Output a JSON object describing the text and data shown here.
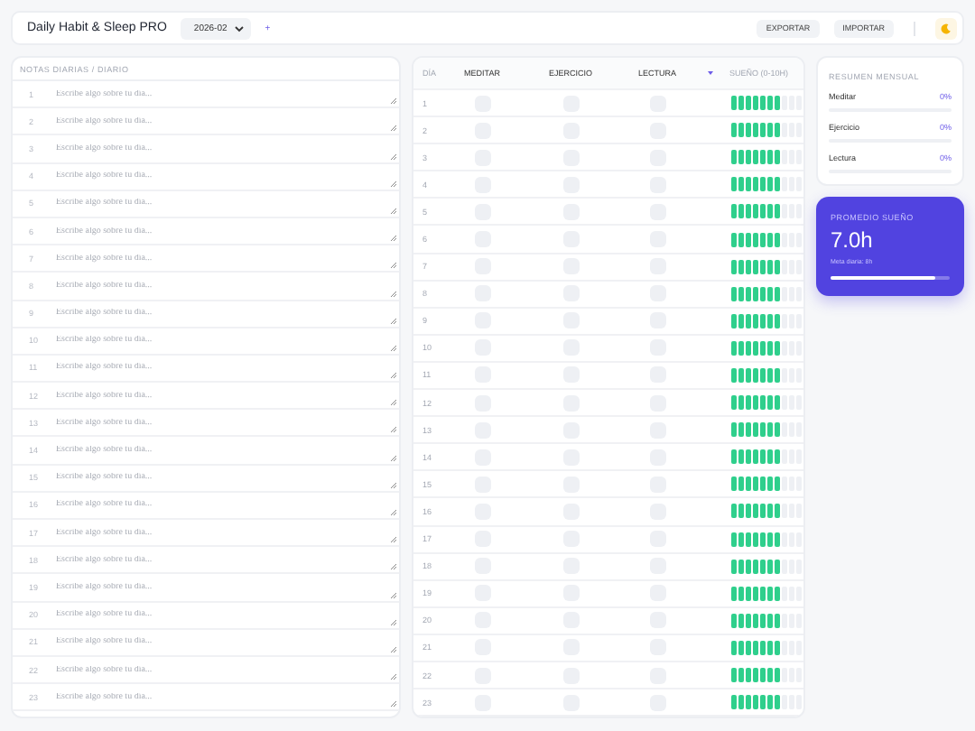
{
  "header": {
    "title": "Daily Habit & Sleep PRO",
    "month": "2026-02",
    "add": "+",
    "buttons": [
      "EXPORTAR",
      "IMPORTAR"
    ]
  },
  "notes": {
    "title": "NOTAS DIARIAS / DIARIO",
    "rows": [
      {
        "day": "1",
        "placeholder": "Escribe algo sobre tu día..."
      },
      {
        "day": "2",
        "placeholder": "Escribe algo sobre tu día..."
      },
      {
        "day": "3",
        "placeholder": "Escribe algo sobre tu día..."
      },
      {
        "day": "4",
        "placeholder": "Escribe algo sobre tu día..."
      },
      {
        "day": "5",
        "placeholder": "Escribe algo sobre tu día..."
      },
      {
        "day": "6",
        "placeholder": "Escribe algo sobre tu día..."
      },
      {
        "day": "7",
        "placeholder": "Escribe algo sobre tu día..."
      },
      {
        "day": "8",
        "placeholder": "Escribe algo sobre tu día..."
      },
      {
        "day": "9",
        "placeholder": "Escribe algo sobre tu día..."
      },
      {
        "day": "10",
        "placeholder": "Escribe algo sobre tu día..."
      },
      {
        "day": "11",
        "placeholder": "Escribe algo sobre tu día..."
      },
      {
        "day": "12",
        "placeholder": "Escribe algo sobre tu día..."
      },
      {
        "day": "13",
        "placeholder": "Escribe algo sobre tu día..."
      },
      {
        "day": "14",
        "placeholder": "Escribe algo sobre tu día..."
      },
      {
        "day": "15",
        "placeholder": "Escribe algo sobre tu día..."
      },
      {
        "day": "16",
        "placeholder": "Escribe algo sobre tu día..."
      },
      {
        "day": "17",
        "placeholder": "Escribe algo sobre tu día..."
      },
      {
        "day": "18",
        "placeholder": "Escribe algo sobre tu día..."
      },
      {
        "day": "19",
        "placeholder": "Escribe algo sobre tu día..."
      },
      {
        "day": "20",
        "placeholder": "Escribe algo sobre tu día..."
      },
      {
        "day": "21",
        "placeholder": "Escribe algo sobre tu día..."
      },
      {
        "day": "22",
        "placeholder": "Escribe algo sobre tu día..."
      },
      {
        "day": "23",
        "placeholder": "Escribe algo sobre tu día..."
      }
    ]
  },
  "tracker": {
    "columns": [
      "DÍA",
      "MEDITAR",
      "EJERCICIO",
      "LECTURA",
      "SUEÑO (0-10H)"
    ],
    "rows": [
      {
        "day": "1",
        "checks": [
          false,
          false,
          false
        ],
        "level": 0.7
      },
      {
        "day": "2",
        "checks": [
          false,
          false,
          false
        ],
        "level": 0.7
      },
      {
        "day": "3",
        "checks": [
          false,
          false,
          false
        ],
        "level": 0.7
      },
      {
        "day": "4",
        "checks": [
          false,
          false,
          false
        ],
        "level": 0.7
      },
      {
        "day": "5",
        "checks": [
          false,
          false,
          false
        ],
        "level": 0.7
      },
      {
        "day": "6",
        "checks": [
          false,
          false,
          false
        ],
        "level": 0.7
      },
      {
        "day": "7",
        "checks": [
          false,
          false,
          false
        ],
        "level": 0.7
      },
      {
        "day": "8",
        "checks": [
          false,
          false,
          false
        ],
        "level": 0.7
      },
      {
        "day": "9",
        "checks": [
          false,
          false,
          false
        ],
        "level": 0.7
      },
      {
        "day": "10",
        "checks": [
          false,
          false,
          false
        ],
        "level": 0.7
      },
      {
        "day": "11",
        "checks": [
          false,
          false,
          false
        ],
        "level": 0.7
      },
      {
        "day": "12",
        "checks": [
          false,
          false,
          false
        ],
        "level": 0.7
      },
      {
        "day": "13",
        "checks": [
          false,
          false,
          false
        ],
        "level": 0.7
      },
      {
        "day": "14",
        "checks": [
          false,
          false,
          false
        ],
        "level": 0.7
      },
      {
        "day": "15",
        "checks": [
          false,
          false,
          false
        ],
        "level": 0.7
      },
      {
        "day": "16",
        "checks": [
          false,
          false,
          false
        ],
        "level": 0.7
      },
      {
        "day": "17",
        "checks": [
          false,
          false,
          false
        ],
        "level": 0.7
      },
      {
        "day": "18",
        "checks": [
          false,
          false,
          false
        ],
        "level": 0.7
      },
      {
        "day": "19",
        "checks": [
          false,
          false,
          false
        ],
        "level": 0.7
      },
      {
        "day": "20",
        "checks": [
          false,
          false,
          false
        ],
        "level": 0.7
      },
      {
        "day": "21",
        "checks": [
          false,
          false,
          false
        ],
        "level": 0.7
      },
      {
        "day": "22",
        "checks": [
          false,
          false,
          false
        ],
        "level": 0.7
      },
      {
        "day": "23",
        "checks": [
          false,
          false,
          false
        ],
        "level": 0.7
      }
    ]
  },
  "summary": {
    "title": "RESUMEN MENSUAL",
    "items": [
      {
        "label": "Meditar",
        "value": "0%"
      },
      {
        "label": "Ejercicio",
        "value": "0%"
      },
      {
        "label": "Lectura",
        "value": "0%"
      }
    ]
  },
  "sleep_card": {
    "title": "PROMEDIO SUEÑO",
    "value": "7.0h",
    "goal": "Meta diaria: 8h",
    "level": 0.875
  }
}
